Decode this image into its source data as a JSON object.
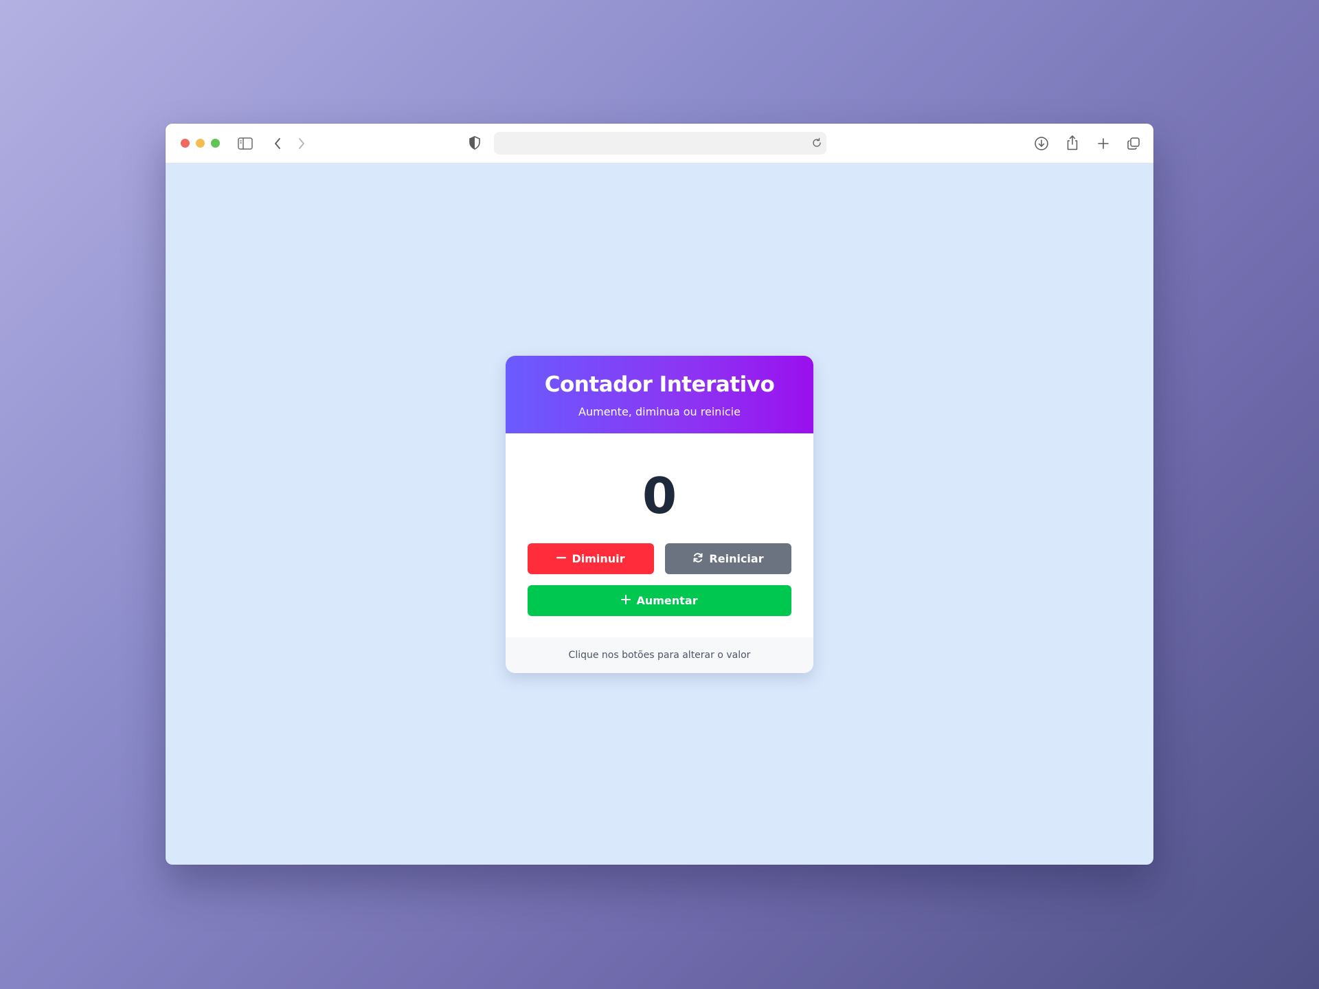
{
  "browser": {
    "icons": {
      "sidebar": "sidebar-icon",
      "back": "chevron-left-icon",
      "forward": "chevron-right-icon",
      "privacy": "shield-icon",
      "reload": "reload-icon",
      "download": "download-icon",
      "share": "share-icon",
      "new_tab": "plus-icon",
      "tabs": "tab-overview-icon"
    },
    "address_value": ""
  },
  "card": {
    "title": "Contador Interativo",
    "subtitle": "Aumente, diminua ou reinicie",
    "count": "0",
    "buttons": {
      "decrease": "Diminuir",
      "reset": "Reiniciar",
      "increase": "Aumentar"
    },
    "footer": "Clique nos botões para alterar o valor"
  },
  "colors": {
    "page_background": "#dae8fc",
    "header_gradient_start": "#6a5cff",
    "header_gradient_end": "#9a10ee",
    "decrease": "#ff2c3b",
    "reset": "#6b7280",
    "increase": "#00c74f",
    "count_text": "#1e293b"
  }
}
